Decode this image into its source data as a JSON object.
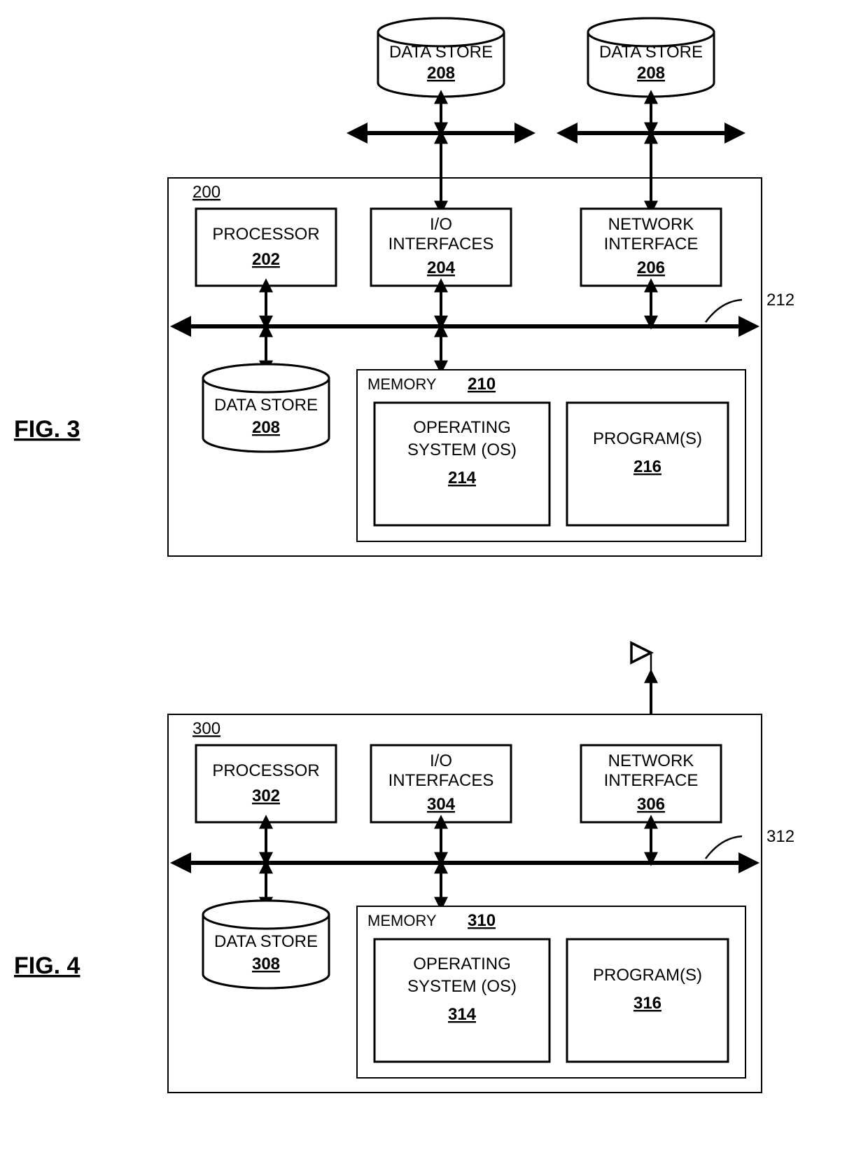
{
  "fig3": {
    "label": "FIG. 3",
    "box_ref": "200",
    "bus_ref": "212",
    "ext_ds1": {
      "label": "DATA STORE",
      "ref": "208"
    },
    "ext_ds2": {
      "label": "DATA STORE",
      "ref": "208"
    },
    "processor": {
      "label": "PROCESSOR",
      "ref": "202"
    },
    "io": {
      "line1": "I/O",
      "line2": "INTERFACES",
      "ref": "204"
    },
    "net": {
      "line1": "NETWORK",
      "line2": "INTERFACE",
      "ref": "206"
    },
    "int_ds": {
      "label": "DATA STORE",
      "ref": "208"
    },
    "memory": {
      "label": "MEMORY",
      "ref": "210",
      "os": {
        "line1": "OPERATING",
        "line2": "SYSTEM (OS)",
        "ref": "214"
      },
      "prog": {
        "label": "PROGRAM(S)",
        "ref": "216"
      }
    }
  },
  "fig4": {
    "label": "FIG. 4",
    "box_ref": "300",
    "bus_ref": "312",
    "processor": {
      "label": "PROCESSOR",
      "ref": "302"
    },
    "io": {
      "line1": "I/O",
      "line2": "INTERFACES",
      "ref": "304"
    },
    "net": {
      "line1": "NETWORK",
      "line2": "INTERFACE",
      "ref": "306"
    },
    "int_ds": {
      "label": "DATA STORE",
      "ref": "308"
    },
    "memory": {
      "label": "MEMORY",
      "ref": "310",
      "os": {
        "line1": "OPERATING",
        "line2": "SYSTEM (OS)",
        "ref": "314"
      },
      "prog": {
        "label": "PROGRAM(S)",
        "ref": "316"
      }
    }
  }
}
